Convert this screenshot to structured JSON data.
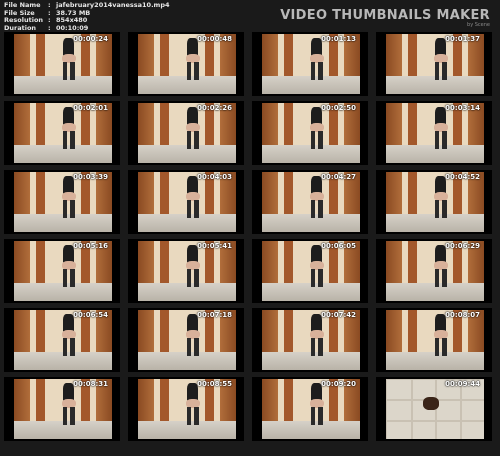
{
  "header": {
    "meta": [
      {
        "key": "File Name",
        "value": "jafebruary2014vanessa10.mp4"
      },
      {
        "key": "File Size",
        "value": "38.73 MB"
      },
      {
        "key": "Resolution",
        "value": "854x480"
      },
      {
        "key": "Duration",
        "value": "00:10:09"
      }
    ],
    "brand_title": "VIDEO THUMBNAILS MAKER",
    "brand_sub": "by Scene"
  },
  "thumbnails": [
    "00:00:24",
    "00:00:48",
    "00:01:13",
    "00:01:37",
    "00:02:01",
    "00:02:26",
    "00:02:50",
    "00:03:14",
    "00:03:39",
    "00:04:03",
    "00:04:27",
    "00:04:52",
    "00:05:16",
    "00:05:41",
    "00:06:05",
    "00:06:29",
    "00:06:54",
    "00:07:18",
    "00:07:42",
    "00:08:07",
    "00:08:31",
    "00:08:55",
    "00:09:20",
    "00:09:44"
  ]
}
